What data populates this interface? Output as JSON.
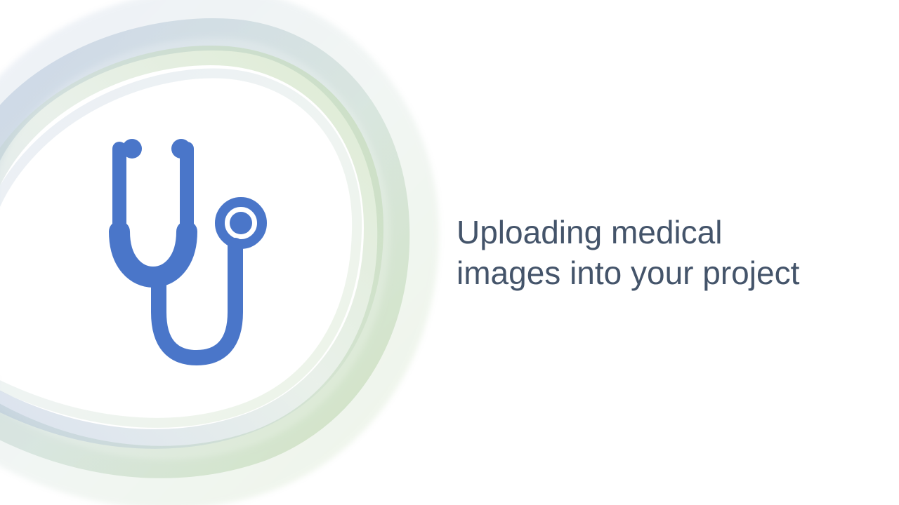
{
  "slide": {
    "title_lines": [
      "Uploading medical",
      "images into your project"
    ]
  },
  "icons": {
    "main": "stethoscope-icon",
    "decoration": "ring-decoration"
  },
  "colors": {
    "icon": "#4a76c9",
    "title": "#44546a",
    "ring_blue": "#9fb3d6",
    "ring_green": "#a8cc8c",
    "background": "#ffffff"
  }
}
